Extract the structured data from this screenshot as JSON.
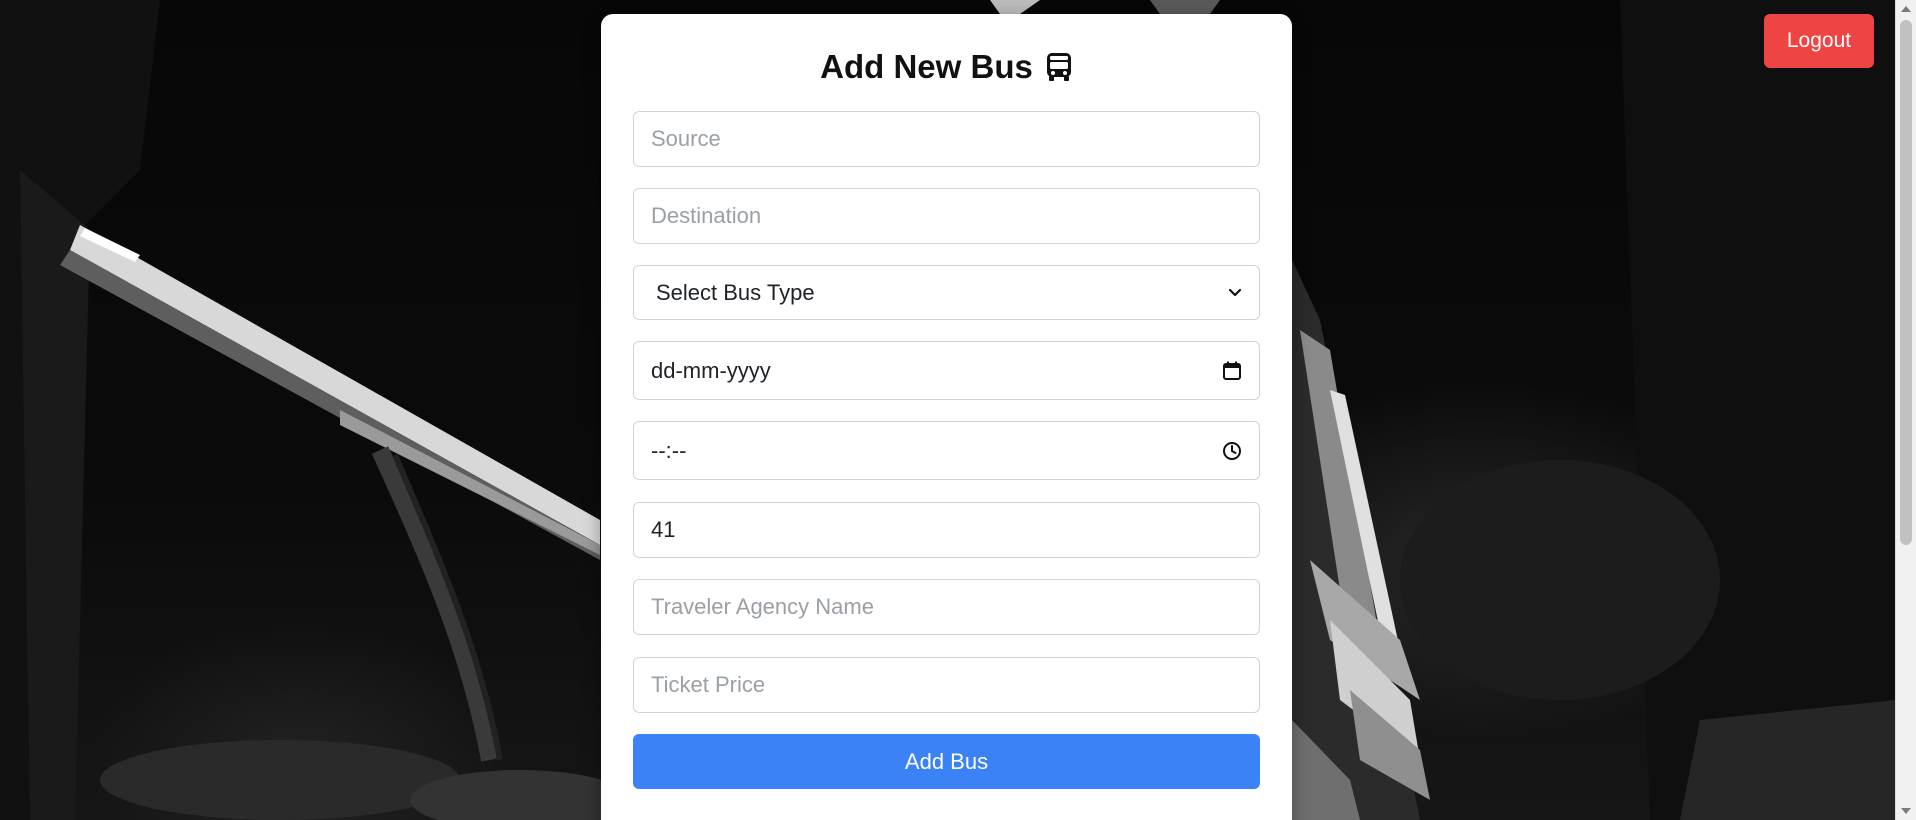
{
  "header": {
    "logout_label": "Logout"
  },
  "form": {
    "title": "Add New Bus",
    "title_icon": "bus-icon",
    "source_placeholder": "Source",
    "destination_placeholder": "Destination",
    "bus_type_selected": "Select Bus Type",
    "date_placeholder": "dd-mm-yyyy",
    "time_placeholder": "--:--",
    "seats_value": "41",
    "agency_placeholder": "Traveler Agency Name",
    "price_placeholder": "Ticket Price",
    "submit_label": "Add Bus"
  },
  "colors": {
    "logout_bg": "#ef4444",
    "submit_bg": "#3b82f6",
    "card_bg": "#ffffff",
    "placeholder": "#9aa0a6"
  }
}
